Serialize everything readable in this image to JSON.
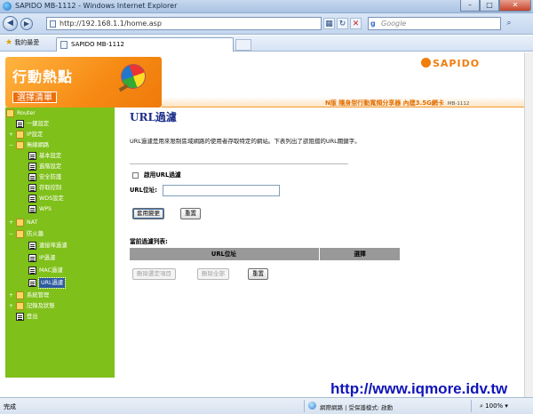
{
  "browser": {
    "window_title": "SAPIDO MB-1112 - Windows Internet Explorer",
    "address": "http://192.168.1.1/home.asp",
    "search_placeholder": "Google",
    "favorites_label": "我的最愛",
    "tab_title": "SAPIDO MB-1112",
    "status_text": "完成",
    "zone_text": "網際網路 | 受保護模式: 啟動",
    "zoom": "100%"
  },
  "header": {
    "brand_title": "行動熱點",
    "menu_label": "選擇清單",
    "logo_text": "SAPIDO",
    "product_text": "N版 隨身型行動寬頻分享器 內建3.5G網卡",
    "model_text": "MB-1112"
  },
  "sidebar": {
    "root": "Router",
    "items": [
      {
        "label": "一鍵設定"
      },
      {
        "label": "IP設定"
      },
      {
        "label": "無線網路"
      },
      {
        "label": "基本設定"
      },
      {
        "label": "進階設定"
      },
      {
        "label": "安全防護"
      },
      {
        "label": "存取控制"
      },
      {
        "label": "WDS設定"
      },
      {
        "label": "WPS"
      },
      {
        "label": "NAT"
      },
      {
        "label": "防火牆"
      },
      {
        "label": "連接埠過濾"
      },
      {
        "label": "IP過濾"
      },
      {
        "label": "MAC過濾"
      },
      {
        "label": "URL過濾"
      },
      {
        "label": "系統管理"
      },
      {
        "label": "記錄及狀態"
      },
      {
        "label": "登出"
      }
    ]
  },
  "content": {
    "title": "URL過濾",
    "description": "URL過濾是用來限制區域網路的使用者存取特定的網站。下表列出了欲阻擋的URL關鍵字。",
    "enable_label": "啟用URL過濾",
    "url_label": "URL位址:",
    "url_value": "",
    "apply_button": "套用變更",
    "reset_button": "重置",
    "list_title": "當前過濾列表:",
    "table_headers": [
      "URL位址",
      "選擇"
    ],
    "delete_selected": "刪除選定項目",
    "delete_all": "刪除全部",
    "reset2_button": "重置"
  },
  "watermark": "http://www.iqmore.idv.tw"
}
